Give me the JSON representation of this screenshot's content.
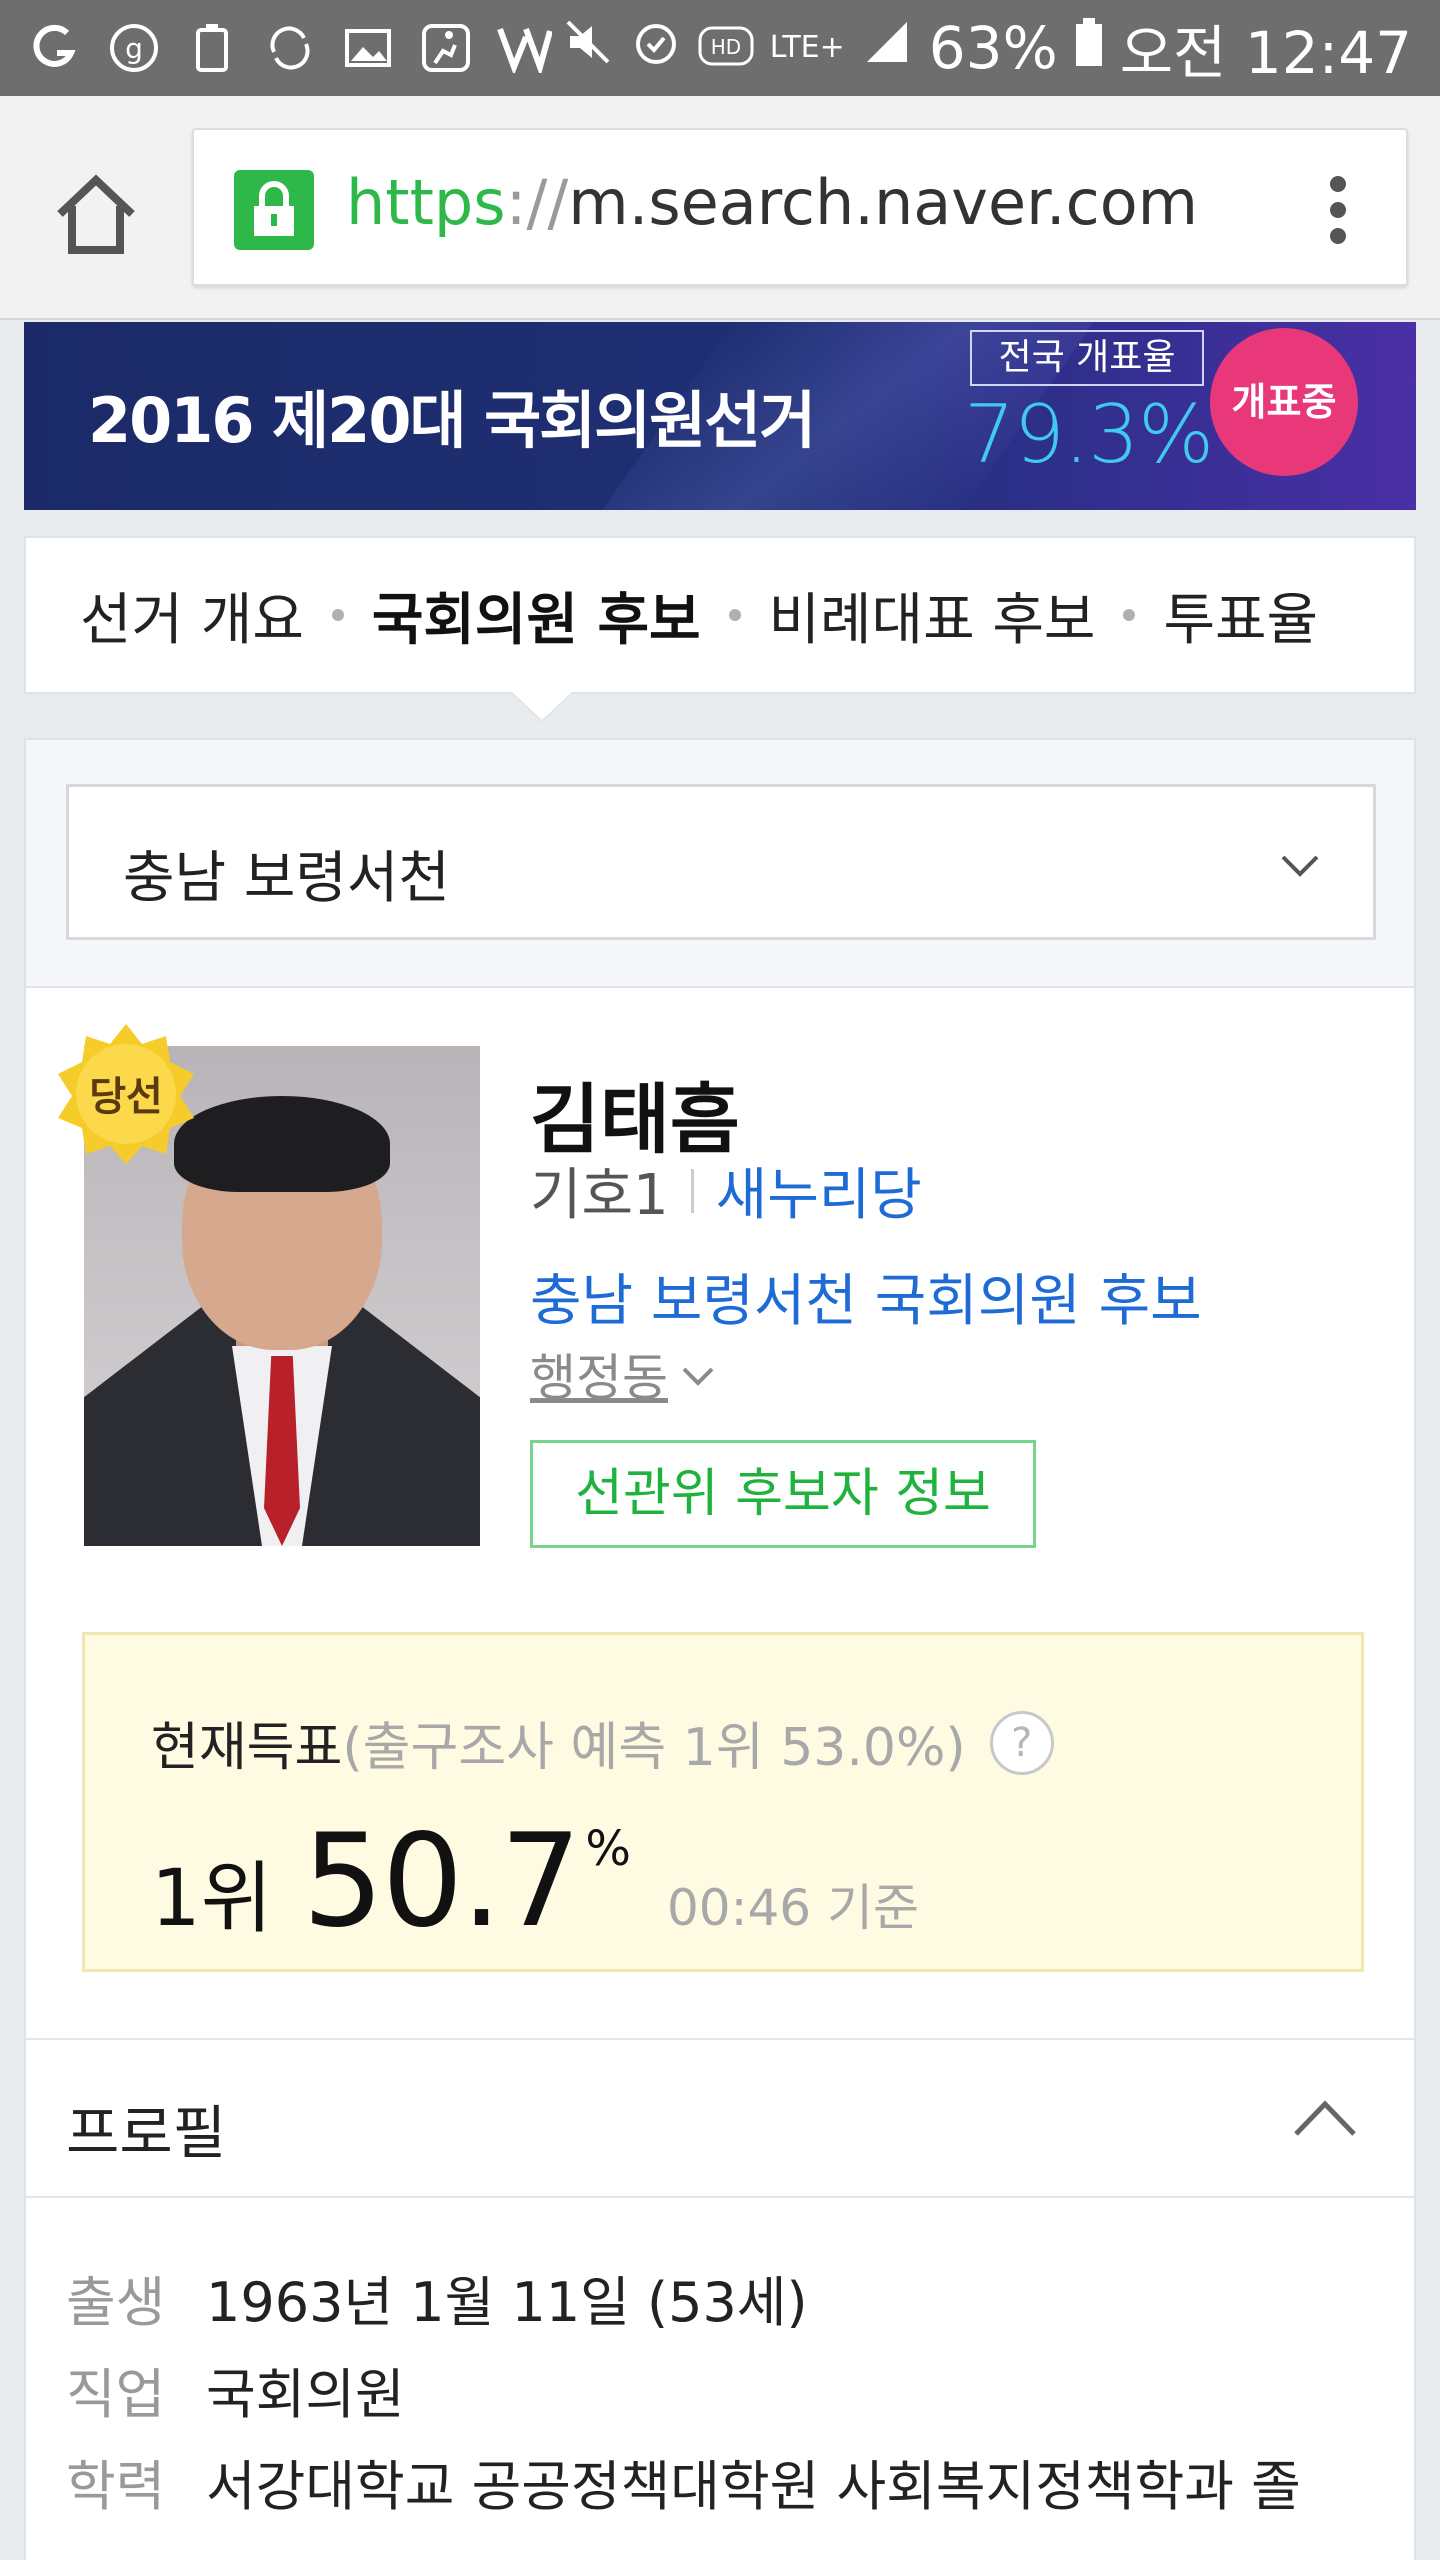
{
  "status_bar": {
    "battery": "63%",
    "time": "오전 12:47",
    "network": "LTE+"
  },
  "browser": {
    "url_scheme": "https",
    "url_sep": "://",
    "url_host": "m.search.naver.com"
  },
  "banner": {
    "title": "2016 제20대 국회의원선거",
    "rate_label": "전국 개표율",
    "rate_value": "79.3%",
    "status_badge": "개표중"
  },
  "tabs": [
    {
      "label": "선거 개요"
    },
    {
      "label": "국회의원 후보"
    },
    {
      "label": "비례대표 후보"
    },
    {
      "label": "투표율"
    }
  ],
  "region": {
    "selected": "충남 보령서천"
  },
  "candidate": {
    "winner_badge": "당선",
    "name": "김태흠",
    "number": "기호1",
    "party": "새누리당",
    "district": "충남 보령서천 국회의원 후보",
    "admin_link": "행정동",
    "nec_button": "선관위 후보자 정보"
  },
  "vote": {
    "label": "현재득표",
    "exit_poll": "(출구조사 예측 1위 53.0%)",
    "help": "?",
    "rank": "1위",
    "percent": "50.7",
    "percent_sign": "%",
    "as_of": "00:46 기준"
  },
  "profile": {
    "title": "프로필",
    "rows": [
      {
        "key": "출생",
        "value": "1963년 1월 11일 (53세)"
      },
      {
        "key": "직업",
        "value": "국회의원"
      },
      {
        "key": "학력",
        "value": "서강대학교 공공정책대학원 사회복지정책학과 졸"
      }
    ]
  },
  "colors": {
    "accent_green": "#2fb84a",
    "link_blue": "#1e6bd6",
    "banner_navy": "#1b2a67",
    "badge_pink": "#e8387a",
    "rate_cyan": "#41c9f0"
  }
}
